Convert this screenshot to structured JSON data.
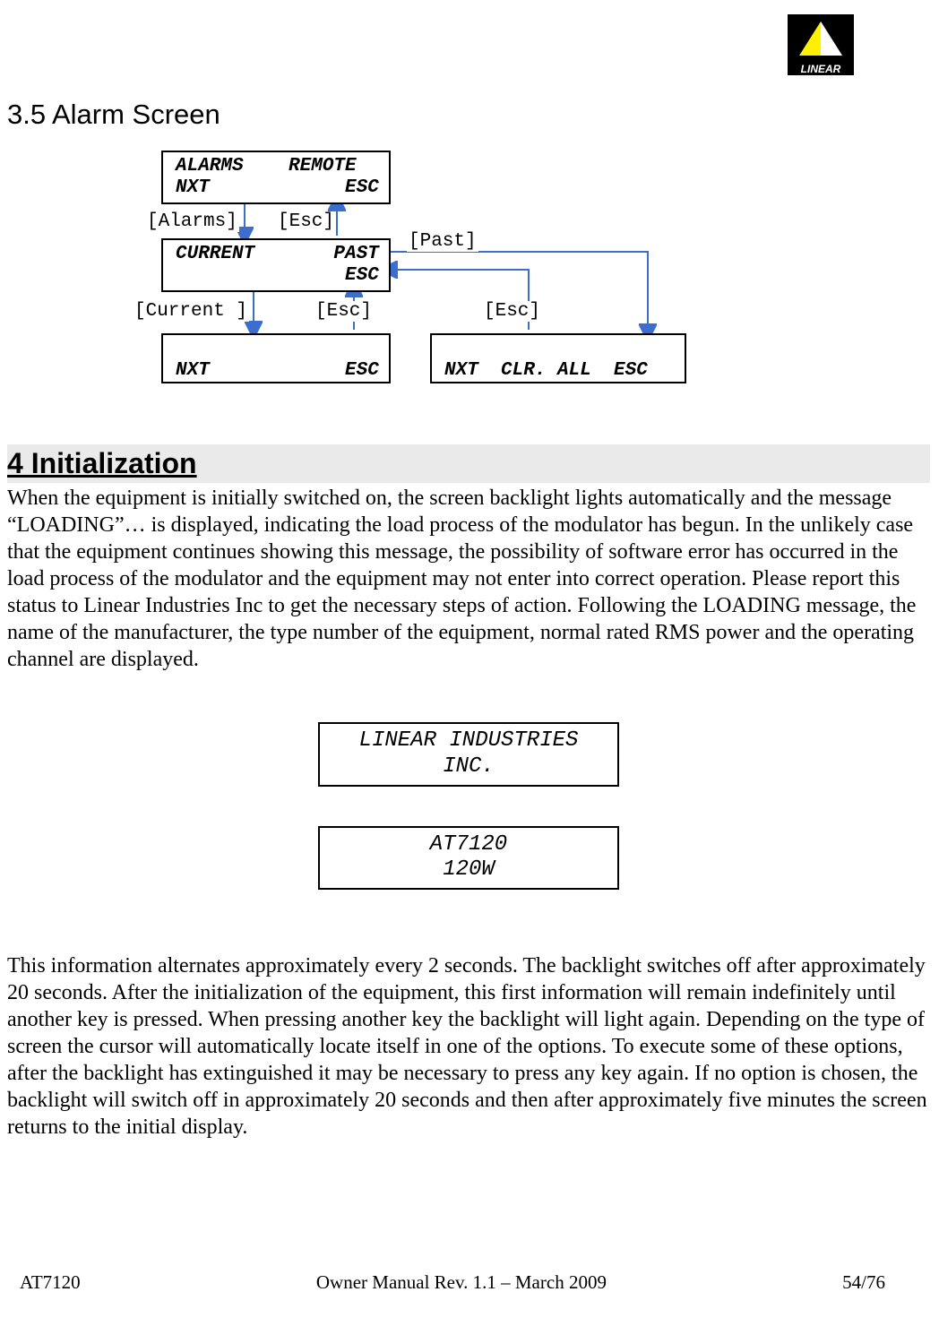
{
  "logo_text": "LINEAR",
  "heading_35": "3.5  Alarm Screen",
  "diagram": {
    "lcd1": "ALARMS    REMOTE\nNXT            ESC",
    "lcd2": "CURRENT       PAST\n               ESC",
    "lcd3": "\nNXT            ESC",
    "lcd4": "\nNXT  CLR. ALL  ESC",
    "lbl_alarms": "[Alarms]",
    "lbl_esc1": "[Esc]",
    "lbl_past": "[Past]",
    "lbl_current": "[Current ]",
    "lbl_esc2": "[Esc]",
    "lbl_esc3": "[Esc]"
  },
  "heading_4": "4 Initialization",
  "para1": "When the equipment is initially switched on, the screen backlight lights automatically and the message “LOADING”… is displayed, indicating the load process of the modulator has begun. In the unlikely case that the equipment continues showing this message, the possibility of software error has occurred in the load process of the modulator and the equipment may not enter into correct operation. Please report this status to Linear Industries Inc to get the necessary steps of action. Following the LOADING message, the name of the manufacturer, the type number of the equipment, normal rated RMS power and the operating channel are displayed.",
  "lcd_center_1a": "LINEAR INDUSTRIES",
  "lcd_center_1b": "INC.",
  "lcd_center_2a": "AT7120",
  "lcd_center_2b": "120W",
  "para2": "This information alternates approximately every 2 seconds. The backlight switches off after approximately 20 seconds. After the initialization of the equipment, this first information will remain indefinitely until another key is pressed. When pressing another key the backlight will light again. Depending on the type of screen the cursor will automatically locate itself in one of the options. To execute some of these options, after the backlight has extinguished it may be necessary to press any key again. If no option is chosen, the backlight will switch off in approximately 20 seconds and then after approximately five minutes the screen returns to the initial display.",
  "footer_left": "AT7120",
  "footer_center": "Owner Manual Rev. 1.1 – March 2009",
  "footer_right": "54/76"
}
